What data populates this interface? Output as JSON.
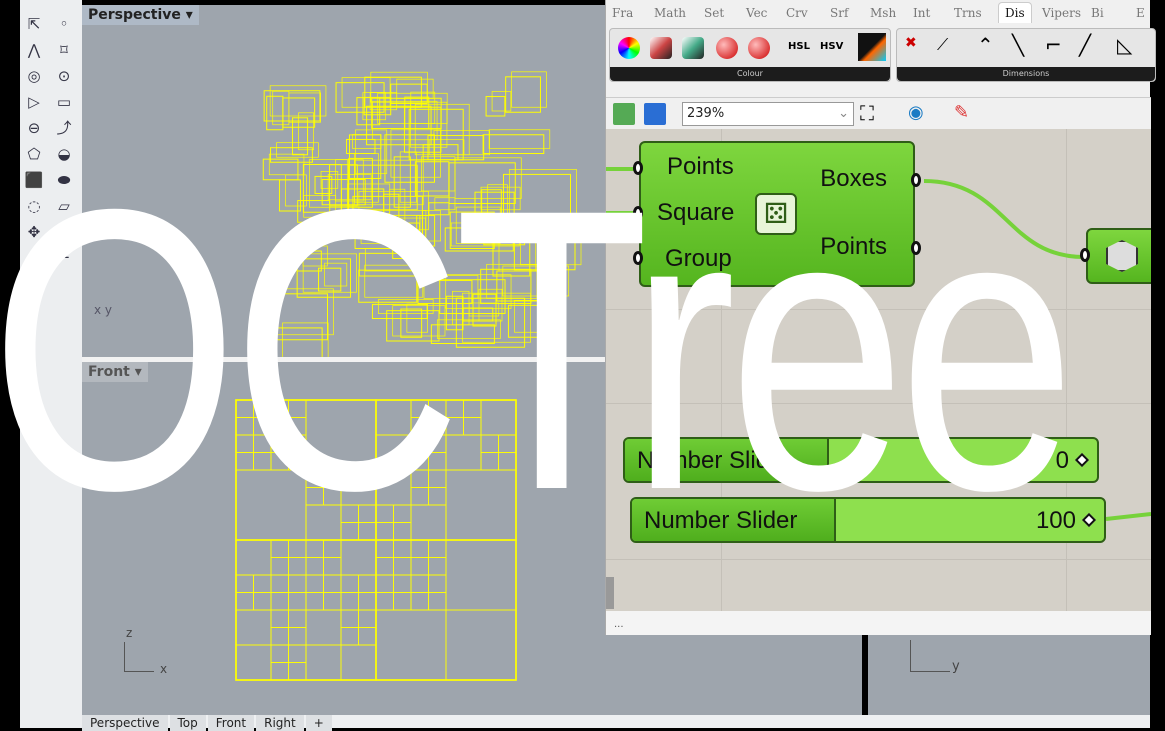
{
  "rhino": {
    "viewports": {
      "perspective": "Perspective",
      "front": "Front"
    },
    "axis_labels": {
      "persp": "x y",
      "z": "z",
      "x": "x",
      "y": "y"
    },
    "bottom_tabs": [
      "Perspective",
      "Top",
      "Front",
      "Right",
      "+"
    ],
    "wire_color": "#ffff00"
  },
  "grasshopper": {
    "tabs": [
      "Fra",
      "Math",
      "Set",
      "Vec",
      "Crv",
      "Srf",
      "Msh",
      "Int",
      "Trns",
      "Dis",
      "Vipers",
      "Bi",
      "E"
    ],
    "active_tab": "Dis",
    "ribbon_groups": [
      "Colour",
      "Dimensions"
    ],
    "ribbon_labels": {
      "hsl": "HSL",
      "hsv": "HSV"
    },
    "zoom": "239%",
    "component": {
      "inputs": [
        "Points",
        "Square",
        "Group"
      ],
      "outputs": [
        "Boxes",
        "Points"
      ]
    },
    "sliders": [
      {
        "name": "Number Slider",
        "value": "0"
      },
      {
        "name": "Number Slider",
        "value": "100"
      }
    ],
    "status": "..."
  },
  "overlay_title": "OCTree"
}
